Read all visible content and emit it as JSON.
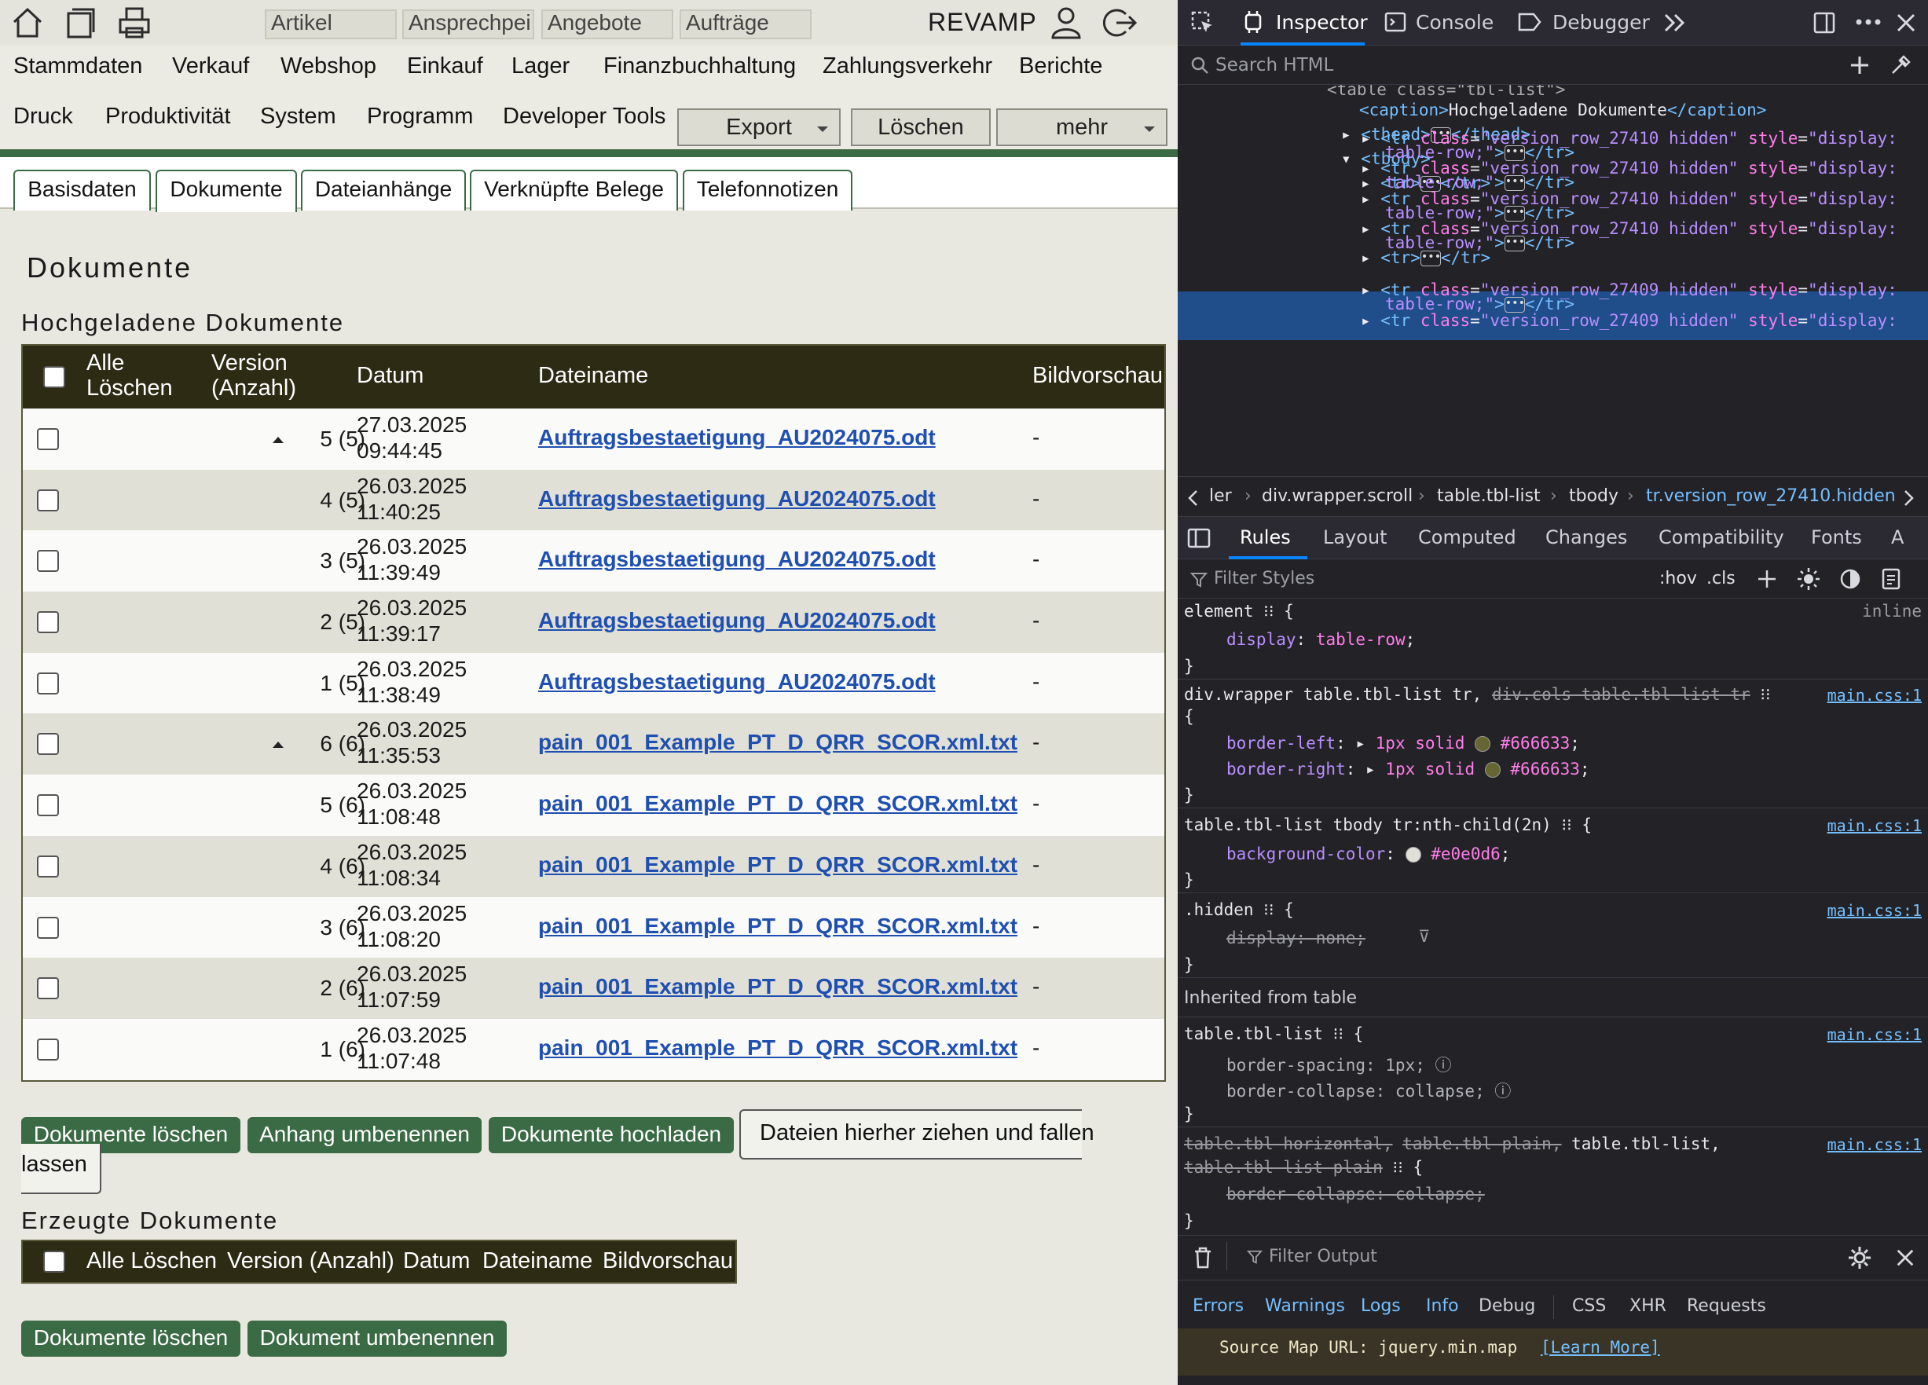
{
  "app": {
    "brand": "REVAMP",
    "quick_tabs": [
      "Artikel",
      "Ansprechpei",
      "Angebote",
      "Aufträge"
    ],
    "menu_row1": [
      "Stammdaten",
      "Verkauf",
      "Webshop",
      "Einkauf",
      "Lager",
      "Finanzbuchhaltung",
      "Zahlungsverkehr",
      "Berichte"
    ],
    "menu_row2": [
      "Druck",
      "Produktivität",
      "System",
      "Programm",
      "Developer Tools"
    ],
    "toolbar": {
      "export": "Export",
      "delete": "Löschen",
      "more": "mehr"
    },
    "tabs": [
      "Basisdaten",
      "Dokumente",
      "Dateianhänge",
      "Verknüpfte Belege",
      "Telefonnotizen"
    ],
    "active_tab": "Dokumente",
    "page_title": "Dokumente",
    "uploaded": {
      "caption": "Hochgeladene Dokumente",
      "headers": {
        "delete_all_1": "Alle",
        "delete_all_2": "Löschen",
        "version_1": "Version",
        "version_2": "(Anzahl)",
        "date": "Datum",
        "filename": "Dateiname",
        "preview": "Bildvorschau"
      },
      "rows": [
        {
          "version": "5 (5)",
          "date": "27.03.2025",
          "time": "09:44:45",
          "file": "Auftragsbestaetigung_AU2024075.odt",
          "preview": "-"
        },
        {
          "version": "4 (5)",
          "date": "26.03.2025",
          "time": "11:40:25",
          "file": "Auftragsbestaetigung_AU2024075.odt",
          "preview": "-"
        },
        {
          "version": "3 (5)",
          "date": "26.03.2025",
          "time": "11:39:49",
          "file": "Auftragsbestaetigung_AU2024075.odt",
          "preview": "-"
        },
        {
          "version": "2 (5)",
          "date": "26.03.2025",
          "time": "11:39:17",
          "file": "Auftragsbestaetigung_AU2024075.odt",
          "preview": "-"
        },
        {
          "version": "1 (5)",
          "date": "26.03.2025",
          "time": "11:38:49",
          "file": "Auftragsbestaetigung_AU2024075.odt",
          "preview": "-"
        },
        {
          "version": "6 (6)",
          "date": "26.03.2025",
          "time": "11:35:53",
          "file": "pain_001_Example_PT_D_QRR_SCOR.xml.txt",
          "preview": "-"
        },
        {
          "version": "5 (6)",
          "date": "26.03.2025",
          "time": "11:08:48",
          "file": "pain_001_Example_PT_D_QRR_SCOR.xml.txt",
          "preview": "-"
        },
        {
          "version": "4 (6)",
          "date": "26.03.2025",
          "time": "11:08:34",
          "file": "pain_001_Example_PT_D_QRR_SCOR.xml.txt",
          "preview": "-"
        },
        {
          "version": "3 (6)",
          "date": "26.03.2025",
          "time": "11:08:20",
          "file": "pain_001_Example_PT_D_QRR_SCOR.xml.txt",
          "preview": "-"
        },
        {
          "version": "2 (6)",
          "date": "26.03.2025",
          "time": "11:07:59",
          "file": "pain_001_Example_PT_D_QRR_SCOR.xml.txt",
          "preview": "-"
        },
        {
          "version": "1 (6)",
          "date": "26.03.2025",
          "time": "11:07:48",
          "file": "pain_001_Example_PT_D_QRR_SCOR.xml.txt",
          "preview": "-"
        }
      ]
    },
    "buttons1": {
      "delete_docs": "Dokumente löschen",
      "rename_attachment": "Anhang umbenennen",
      "upload_docs": "Dokumente hochladen"
    },
    "dropzone": {
      "line1": "Dateien hierher ziehen und fallen",
      "line2": "lassen"
    },
    "generated": {
      "caption": "Erzeugte Dokumente",
      "headers": {
        "delete_all": "Alle Löschen",
        "version": "Version (Anzahl)",
        "date": "Datum",
        "filename": "Dateiname",
        "preview": "Bildvorschau"
      }
    },
    "buttons2": {
      "delete_docs": "Dokumente löschen",
      "rename_doc": "Dokument umbenennen"
    },
    "colors": {
      "accent_green": "#3b6b45",
      "table_header": "#2e2b14",
      "link": "#1f4fb0",
      "even_row": "#e0e0d6"
    }
  },
  "devtools": {
    "tabs": {
      "inspector": "Inspector",
      "console": "Console",
      "debugger": "Debugger"
    },
    "search_placeholder": "Search HTML",
    "code": {
      "l0": "<table class=\"tbl-list\">",
      "caption_text": "Hochgeladene Dokumente",
      "row_class_27410": "version_row_27410 hidden",
      "row_class_27409": "version_row_27409 hidden",
      "style_display": "display:",
      "style_value": "table-row;"
    },
    "breadcrumbs": [
      "ler",
      "div.wrapper.scroll",
      "table.tbl-list",
      "tbody",
      "tr.version_row_27410.hidden"
    ],
    "side_tabs": [
      "Rules",
      "Layout",
      "Computed",
      "Changes",
      "Compatibility",
      "Fonts",
      "A"
    ],
    "filter_placeholder": "Filter Styles",
    "pseudo": {
      "hov": ":hov",
      "cls": ".cls"
    },
    "rules": {
      "element": "element",
      "inline": "inline",
      "display": "display",
      "table_row": "table-row",
      "rule2_sel": "div.wrapper table.tbl-list tr,",
      "rule2_sel_strike": "div.cols table.tbl-list tr",
      "border_left": "border-left",
      "border_right": "border-right",
      "border_val": "1px solid",
      "border_color": "#666633",
      "rule3_sel": "table.tbl-list tbody tr:nth-child(2n)",
      "bg_prop": "background-color",
      "bg_val": "#e0e0d6",
      "rule4_sel": ".hidden",
      "display_none": "display: none;",
      "inherited": "Inherited from table",
      "rule5_sel": "table.tbl-list",
      "border_spacing": "border-spacing: 1px;",
      "border_collapse": "border-collapse: collapse;",
      "rule6_sel_strike1": "table.tbl-horizontal,",
      "rule6_sel_strike2": "table.tbl-plain,",
      "rule6_sel": "table.tbl-list,",
      "rule6_sel_strike3": "table.tbl-list-plain",
      "source": "main.css:1"
    },
    "console": {
      "filter_placeholder": "Filter Output",
      "tabs": [
        "Errors",
        "Warnings",
        "Logs",
        "Info",
        "Debug",
        "CSS",
        "XHR",
        "Requests"
      ],
      "message": "Source Map URL: jquery.min.map",
      "learn_more": "[Learn More]"
    }
  }
}
